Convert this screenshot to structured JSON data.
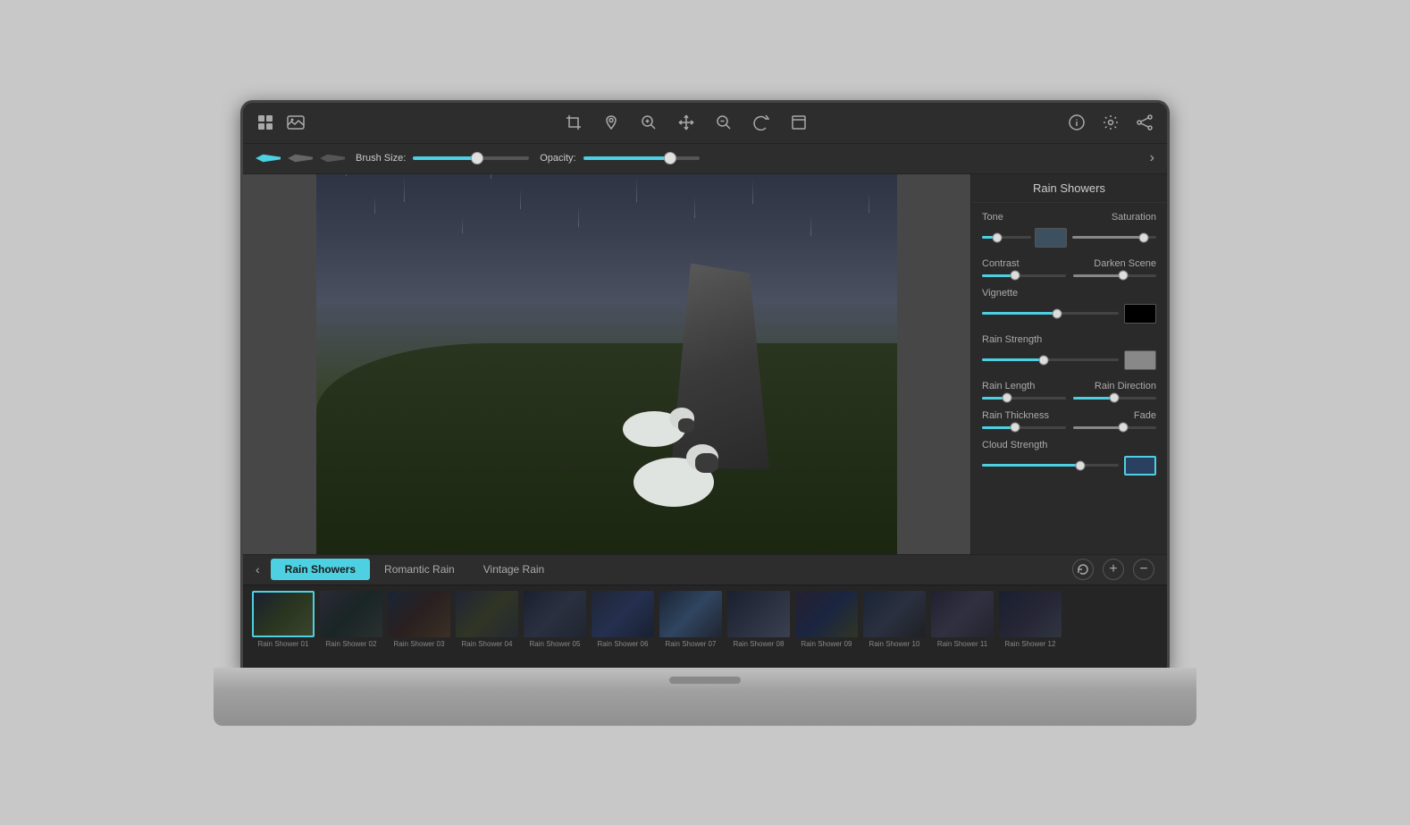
{
  "app": {
    "title": "Rain Showers"
  },
  "toolbar": {
    "icons": [
      "grid-icon",
      "photo-icon",
      "crop-icon",
      "pin-icon",
      "zoom-in-icon",
      "move-icon",
      "zoom-out-icon",
      "redo-icon",
      "fullscreen-icon"
    ],
    "right_icons": [
      "info-icon",
      "settings-icon",
      "share-icon"
    ]
  },
  "brush_toolbar": {
    "brush_size_label": "Brush Size:",
    "opacity_label": "Opacity:",
    "brush_size_value": 55,
    "opacity_value": 75
  },
  "right_panel": {
    "title": "Rain Showers",
    "controls": [
      {
        "label": "Tone",
        "type": "slider-swatch",
        "value": 30,
        "swatch_color": "#3d5060"
      },
      {
        "label": "Saturation",
        "type": "slider",
        "value": 85,
        "fill_type": "gray"
      },
      {
        "label": "Contrast",
        "type": "slider",
        "value": 40,
        "fill_type": "cyan"
      },
      {
        "label": "Darken Scene",
        "type": "slider",
        "value": 60,
        "fill_type": "gray"
      },
      {
        "label": "Vignette",
        "type": "slider-swatch",
        "value": 55,
        "swatch_color": "#000000"
      },
      {
        "label": "Rain Strength",
        "type": "slider-swatch",
        "value": 45,
        "swatch_color": "#888888"
      },
      {
        "label": "Rain Length",
        "type": "slider",
        "value": 30,
        "fill_type": "cyan"
      },
      {
        "label": "Rain Direction",
        "type": "slider",
        "value": 50,
        "fill_type": "cyan"
      },
      {
        "label": "Rain Thickness",
        "type": "slider",
        "value": 40,
        "fill_type": "cyan"
      },
      {
        "label": "Fade",
        "type": "slider",
        "value": 60,
        "fill_type": "gray"
      },
      {
        "label": "Cloud Strength",
        "type": "slider-swatch",
        "value": 72,
        "swatch_color": "#2a4060"
      }
    ]
  },
  "tabs": {
    "items": [
      {
        "label": "Rain Showers",
        "active": true
      },
      {
        "label": "Romantic Rain",
        "active": false
      },
      {
        "label": "Vintage Rain",
        "active": false
      }
    ]
  },
  "filmstrip": {
    "items": [
      {
        "label": "Rain Shower 01",
        "active": true
      },
      {
        "label": "Rain Shower 02",
        "active": false
      },
      {
        "label": "Rain Shower 03",
        "active": false
      },
      {
        "label": "Rain Shower 04",
        "active": false
      },
      {
        "label": "Rain Shower 05",
        "active": false
      },
      {
        "label": "Rain Shower 06",
        "active": false
      },
      {
        "label": "Rain Shower 07",
        "active": false
      },
      {
        "label": "Rain Shower 08",
        "active": false
      },
      {
        "label": "Rain Shower 09",
        "active": false
      },
      {
        "label": "Rain Shower 10",
        "active": false
      },
      {
        "label": "Rain Shower 11",
        "active": false
      },
      {
        "label": "Rain Shower 12",
        "active": false
      }
    ]
  }
}
